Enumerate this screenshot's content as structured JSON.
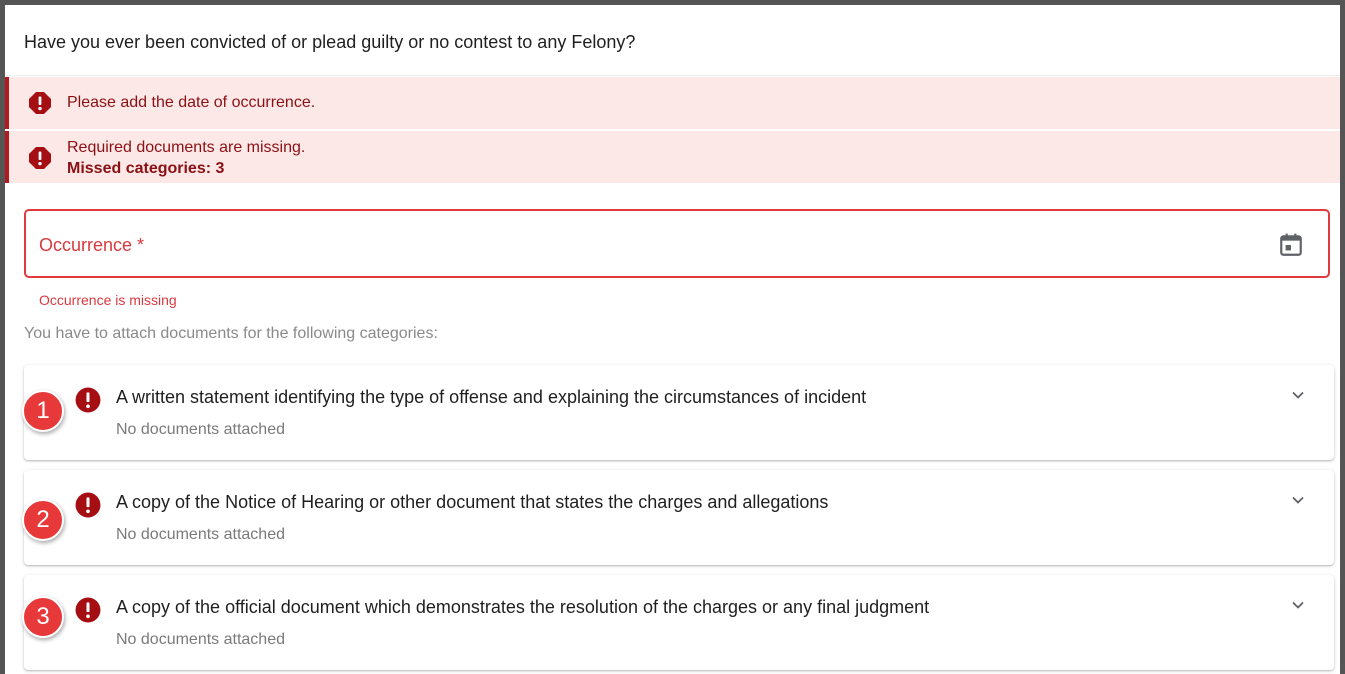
{
  "question": "Have you ever been convicted of or plead guilty or no contest to any Felony?",
  "alerts": [
    {
      "text": "Please add the date of occurrence."
    },
    {
      "text": "Required documents are missing.",
      "detail": "Missed categories: 3"
    }
  ],
  "occurrence_field": {
    "label": "Occurrence *",
    "value": "",
    "error": "Occurrence is missing",
    "icon": "calendar-icon"
  },
  "intro": "You have to attach documents for the following categories:",
  "categories": [
    {
      "badge": "1",
      "title": "A written statement identifying the type of offense and explaining the circumstances of incident",
      "status": "No documents attached"
    },
    {
      "badge": "2",
      "title": "A copy of the Notice of Hearing or other document that states the charges and allegations",
      "status": "No documents attached"
    },
    {
      "badge": "3",
      "title": "A copy of the official document which demonstrates the resolution of the charges or any final judgment",
      "status": "No documents attached"
    }
  ],
  "colors": {
    "error_red": "#d9393e",
    "alert_bg": "#fde8e8",
    "alert_text": "#8b1014",
    "error_icon": "#a50e13",
    "badge": "#e8393a"
  }
}
